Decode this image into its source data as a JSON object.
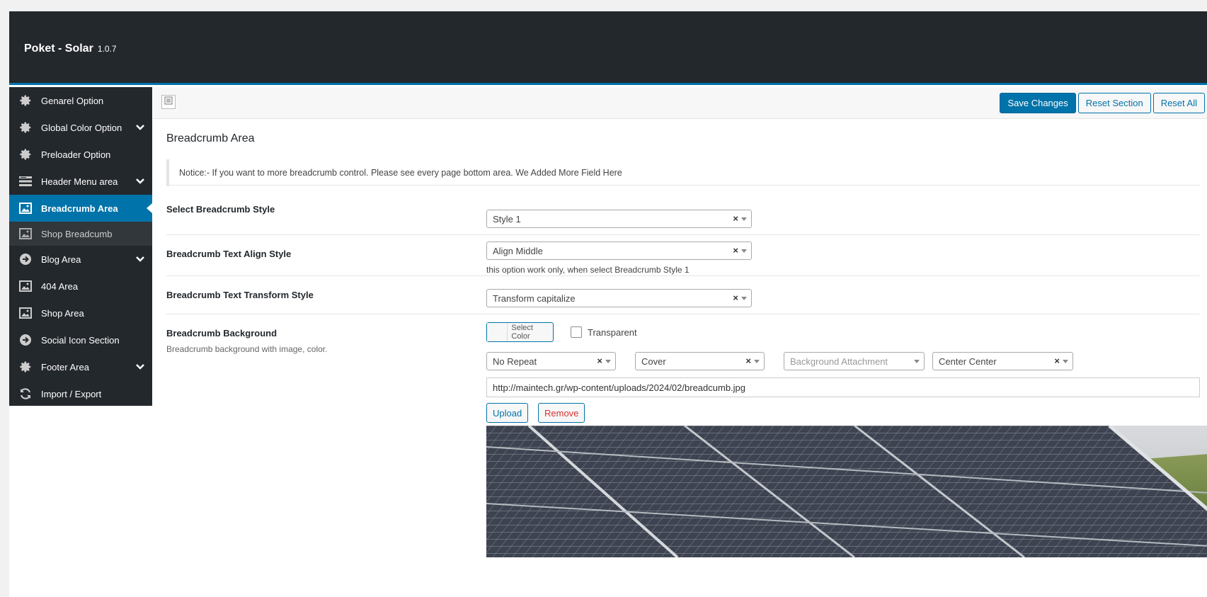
{
  "header": {
    "title": "Poket - Solar",
    "version": "1.0.7"
  },
  "sidebar": {
    "items": [
      {
        "label": "Genarel Option",
        "icon": "gear-icon"
      },
      {
        "label": "Global Color Option",
        "icon": "gear-icon",
        "chevron": true
      },
      {
        "label": "Preloader Option",
        "icon": "gear-icon"
      },
      {
        "label": "Header Menu area",
        "icon": "menu-icon",
        "chevron": true
      },
      {
        "label": "Breadcrumb Area",
        "icon": "image-icon",
        "active": true
      },
      {
        "label": "Shop Breadcumb",
        "icon": "image-icon",
        "sub": true
      },
      {
        "label": "Blog Area",
        "icon": "arrow-circle-icon",
        "chevron": true
      },
      {
        "label": "404 Area",
        "icon": "image-icon"
      },
      {
        "label": "Shop Area",
        "icon": "image-icon"
      },
      {
        "label": "Social Icon Section",
        "icon": "arrow-circle-icon"
      },
      {
        "label": "Footer Area",
        "icon": "gear-icon",
        "chevron": true
      },
      {
        "label": "Import / Export",
        "icon": "refresh-icon"
      }
    ]
  },
  "toolbar": {
    "save": "Save Changes",
    "reset_section": "Reset Section",
    "reset_all": "Reset All"
  },
  "section": {
    "title": "Breadcrumb Area",
    "notice": "Notice:- If you want to more breadcrumb control. Please see every page bottom area. We Added More Field Here"
  },
  "fields": {
    "style": {
      "label": "Select Breadcrumb Style",
      "value": "Style 1"
    },
    "align": {
      "label": "Breadcrumb Text Align Style",
      "value": "Align Middle",
      "hint": "this option work only, when select Breadcrumb Style 1"
    },
    "transform": {
      "label": "Breadcrumb Text Transform Style",
      "value": "Transform capitalize"
    },
    "background": {
      "label": "Breadcrumb Background",
      "desc": "Breadcrumb background with image, color.",
      "select_color": "Select Color",
      "transparent": "Transparent",
      "repeat": "No Repeat",
      "size": "Cover",
      "attachment_placeholder": "Background Attachment",
      "position": "Center Center",
      "url": "http://maintech.gr/wp-content/uploads/2024/02/breadcumb.jpg",
      "upload": "Upload",
      "remove": "Remove"
    }
  },
  "colors": {
    "header_bg": "#23282d",
    "accent": "#0073aa",
    "remove": "#dc3232"
  }
}
